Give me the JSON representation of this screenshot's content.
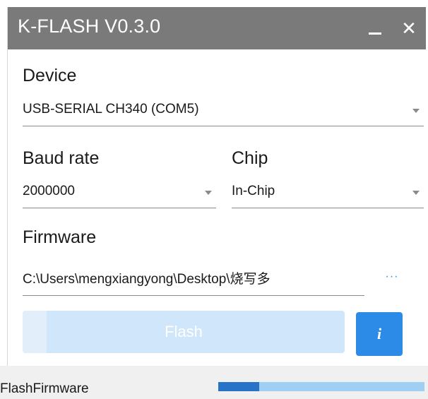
{
  "window": {
    "title": "K-FLASH V0.3.0",
    "minimize_icon": "minimize-icon",
    "close_icon": "close-icon",
    "close_glyph": "✕"
  },
  "device": {
    "label": "Device",
    "value": "USB-SERIAL CH340 (COM5)"
  },
  "baud_rate": {
    "label": "Baud rate",
    "value": "2000000"
  },
  "chip": {
    "label": "Chip",
    "value": "In-Chip"
  },
  "firmware": {
    "label": "Firmware",
    "value": "C:\\Users\\mengxiangyong\\Desktop\\烧写多",
    "browse_label": "···"
  },
  "actions": {
    "flash_label": "Flash",
    "info_label": "i"
  },
  "status": {
    "text": "FlashFirmware",
    "progress": 0.2
  },
  "colors": {
    "titlebar": "#7a7a7a",
    "accent": "#2b8be6",
    "flash_disabled": "#cfe6fb",
    "progress_fill": "#2773c7",
    "progress_track": "#9fcff3"
  }
}
